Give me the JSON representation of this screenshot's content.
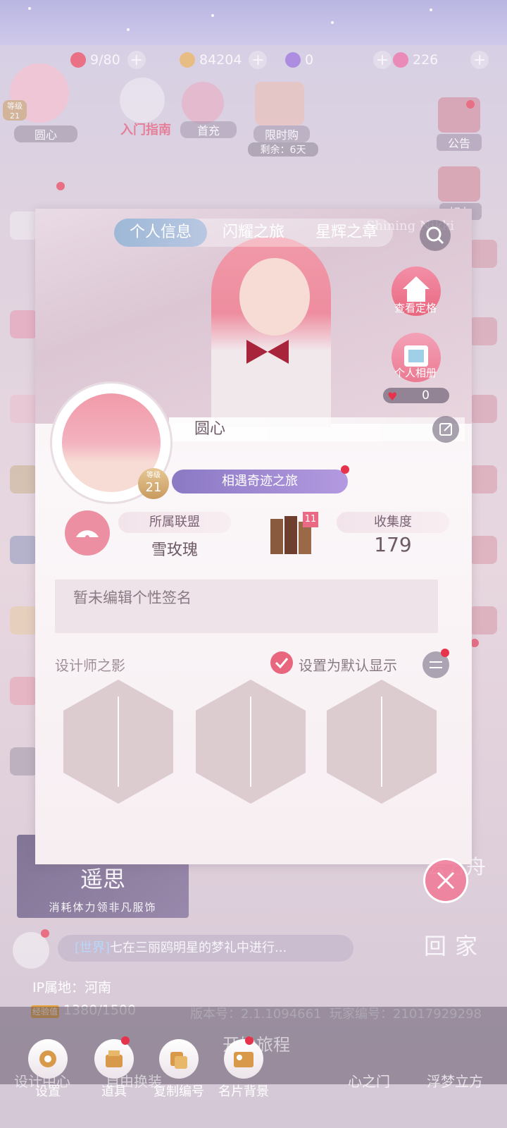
{
  "resources": [
    {
      "name": "heart-icon",
      "value": "9/80",
      "color": "#e8324c"
    },
    {
      "name": "coin-icon",
      "value": "84204",
      "color": "#e6a84a"
    },
    {
      "name": "diamond-icon",
      "value": "0",
      "color": "#8a5fd6"
    },
    {
      "name": "gem-icon",
      "value": "226",
      "color": "#e85a9a"
    }
  ],
  "background": {
    "avatar_label": "圆心",
    "level_label": "等级",
    "level": "21",
    "guide_label": "入门指南",
    "first_charge": "首充",
    "limited": "限时购",
    "limited_remain": "剩余：6天",
    "announcement": "公告",
    "friends": "好友",
    "banner_title": "遥思",
    "banner_sub": "消耗体力领非凡服饰",
    "chat": "七在三丽鸥明星的梦礼中进行...",
    "chat_tag": "[世界]",
    "go_home": "回家",
    "side_right": "去方舟"
  },
  "panel": {
    "tabs": [
      "个人信息",
      "闪耀之旅",
      "星辉之章"
    ],
    "watermark": "Shining Nikki",
    "view_stage": "查看定格",
    "album": "个人相册",
    "likes": "0",
    "name": "圆心",
    "level_label": "等级",
    "level": "21",
    "journey": "相遇奇迹之旅",
    "alliance_label": "所属联盟",
    "alliance": "雪玫瑰",
    "book_badge": "11",
    "collection_label": "收集度",
    "collection": "179",
    "signature": "暂未编辑个性签名",
    "designer_label": "设计师之影",
    "default_label": "设置为默认显示"
  },
  "footer": {
    "ip": "IP属地：河南",
    "exp_tag": "经验值",
    "exp": "1380/1500",
    "version": "版本号：2.1.1094661",
    "player_id": "玩家编号：21017929298"
  },
  "nav": [
    {
      "label": "设置",
      "icon": "gear-icon"
    },
    {
      "label": "道具",
      "icon": "item-icon"
    },
    {
      "label": "复制编号",
      "icon": "copy-icon"
    },
    {
      "label": "名片背景",
      "icon": "card-icon"
    }
  ],
  "nav_bg": [
    "设计中心",
    "自由换装",
    "开始旅程",
    "心之门",
    "浮梦立方"
  ]
}
